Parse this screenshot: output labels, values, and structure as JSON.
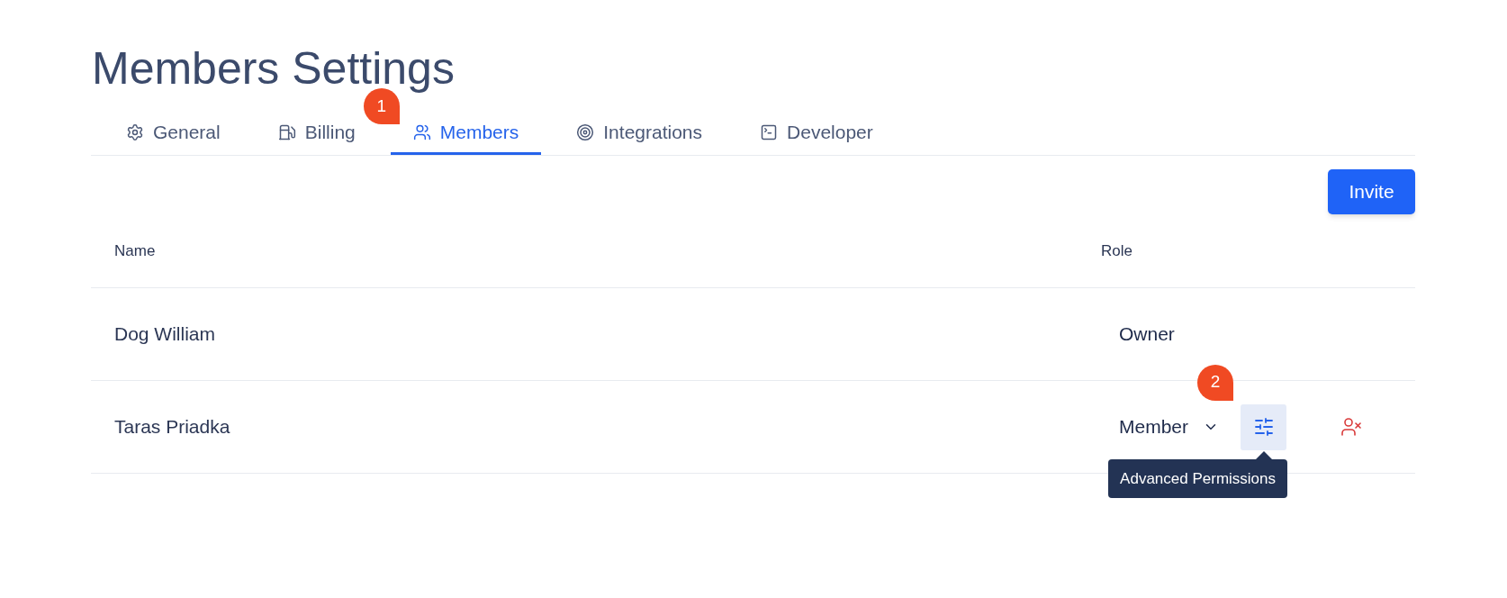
{
  "title": "Members Settings",
  "tabs": [
    {
      "label": "General",
      "selected": false
    },
    {
      "label": "Billing",
      "selected": false
    },
    {
      "label": "Members",
      "selected": true,
      "callout": "1"
    },
    {
      "label": "Integrations",
      "selected": false
    },
    {
      "label": "Developer",
      "selected": false
    }
  ],
  "invite_button": "Invite",
  "table": {
    "columns": [
      "Name",
      "Role"
    ],
    "rows": [
      {
        "name": "Dog William",
        "role": "Owner",
        "kind": "fixed"
      },
      {
        "name": "Taras Priadka",
        "role": "Member",
        "kind": "editable",
        "callout": "2",
        "tooltip": "Advanced Permissions"
      }
    ]
  }
}
